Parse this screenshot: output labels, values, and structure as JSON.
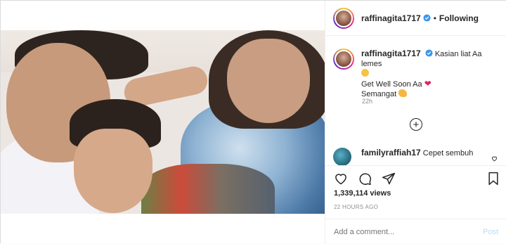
{
  "post": {
    "author": "raffinagita1717",
    "separator": "•",
    "follow_label": "Following",
    "caption_line1": "Kasian liat Aa lemes",
    "caption_line2": "Get Well Soon Aa",
    "caption_line3": "Semangat",
    "timestamp": "22h",
    "views": "1,339,114 views",
    "posted_ago": "22 HOURS AGO"
  },
  "comments": [
    {
      "user": "familyraffiah17",
      "text": "Cepet sembuh"
    }
  ],
  "comment_box": {
    "placeholder": "Add a comment...",
    "post_label": "Post"
  },
  "icons": {
    "verified": "verified-badge-icon",
    "mute": "mute-icon",
    "load_more": "plus-circle-icon",
    "like": "heart-icon",
    "comment": "comment-bubble-icon",
    "share": "paper-plane-icon",
    "save": "bookmark-icon"
  },
  "colors": {
    "verified": "#3897f0",
    "heart_emoji": "#e0245e",
    "post_disabled": "#b2dffc",
    "muted_text": "#8e8e8e"
  }
}
